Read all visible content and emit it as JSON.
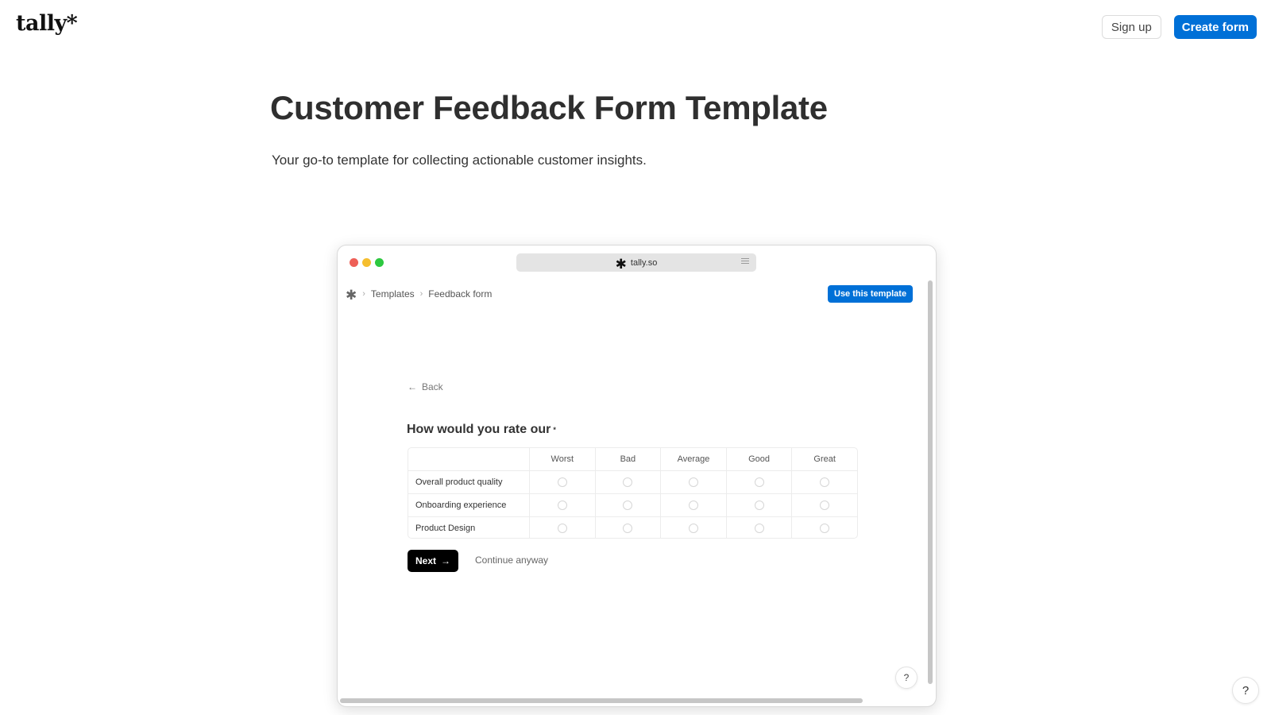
{
  "header": {
    "logo": "tally*",
    "signup_label": "Sign up",
    "create_label": "Create form"
  },
  "hero": {
    "title": "Customer Feedback Form Template",
    "subtitle": "Your go-to template for collecting actionable customer insights."
  },
  "preview": {
    "url": "tally.so",
    "traffic_lights": [
      "#ee5f57",
      "#f5be2f",
      "#2dc840"
    ],
    "breadcrumb": [
      "Templates",
      "Feedback form"
    ],
    "use_template_label": "Use this template",
    "back_label": "Back",
    "question": "How would you rate our",
    "required_marker": "*",
    "matrix": {
      "columns": [
        "Worst",
        "Bad",
        "Average",
        "Good",
        "Great"
      ],
      "rows": [
        "Overall product quality",
        "Onboarding experience",
        "Product Design"
      ]
    },
    "next_label": "Next",
    "continue_label": "Continue anyway",
    "help_label": "?"
  },
  "help_label": "?",
  "colors": {
    "accent": "#0070d7",
    "next_button": "#000000"
  }
}
